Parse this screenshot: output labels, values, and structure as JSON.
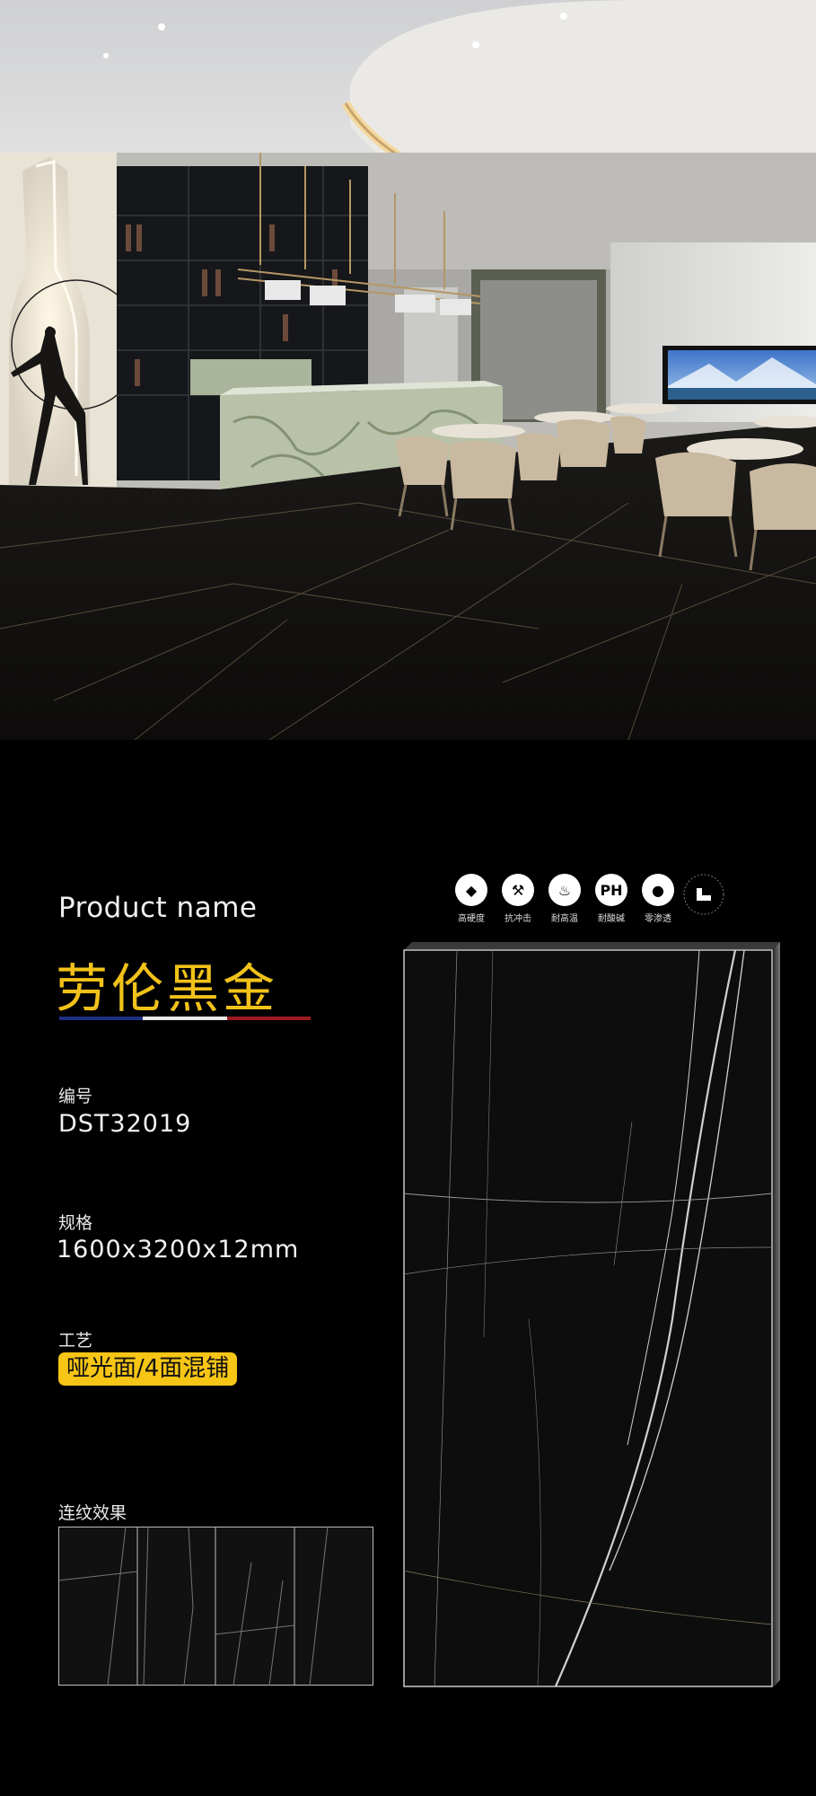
{
  "product": {
    "label_en": "Product name",
    "name_cn": "劳伦黑金",
    "flag_colors": [
      "#1e2f82",
      "#e9e9e9",
      "#9c1a22"
    ]
  },
  "specs": {
    "code_label": "编号",
    "code_value": "DST32019",
    "size_label": "规格",
    "size_value": "1600x3200x12mm",
    "craft_label": "工艺",
    "craft_value": "哑光面/4面混铺",
    "pattern_label": "连纹效果"
  },
  "features": [
    {
      "icon": "diamond-icon",
      "glyph": "◆",
      "caption": "高硬度"
    },
    {
      "icon": "hammer-icon",
      "glyph": "⚒",
      "caption": "抗冲击"
    },
    {
      "icon": "flame-icon",
      "glyph": "♨",
      "caption": "耐高温"
    },
    {
      "icon": "ph-icon",
      "glyph": "PH",
      "caption": "耐酸碱"
    },
    {
      "icon": "water-drop-icon",
      "glyph": "●",
      "caption": "零渗透"
    }
  ],
  "colors": {
    "accent_gold": "#f2c21a",
    "badge_yellow": "#f7c515",
    "background": "#000000"
  }
}
